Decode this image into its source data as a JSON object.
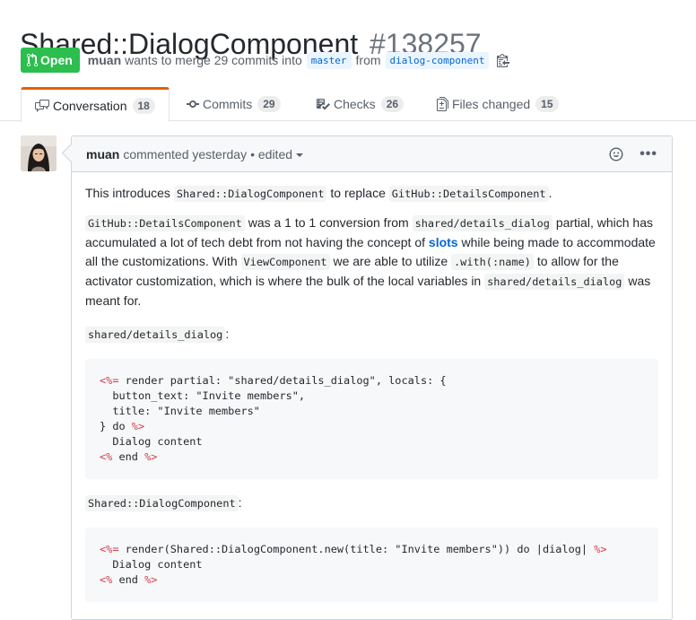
{
  "pr": {
    "title": "Shared::DialogComponent",
    "number": "#138257",
    "state": "Open",
    "author": "muan",
    "merge_text": "wants to merge 29 commits into",
    "base_branch": "master",
    "from_text": "from",
    "head_branch": "dialog-component"
  },
  "tabs": [
    {
      "label": "Conversation",
      "count": "18",
      "icon": "comment-discussion-icon"
    },
    {
      "label": "Commits",
      "count": "29",
      "icon": "commit-icon"
    },
    {
      "label": "Checks",
      "count": "26",
      "icon": "checklist-icon"
    },
    {
      "label": "Files changed",
      "count": "15",
      "icon": "file-diff-icon"
    }
  ],
  "comment": {
    "author": "muan",
    "meta": "commented yesterday",
    "edited": "• edited",
    "p1": {
      "a": "This introduces",
      "code1": "Shared::DialogComponent",
      "b": "to replace",
      "code2": "GitHub::DetailsComponent",
      "c": "."
    },
    "p2": {
      "code1": "GitHub::DetailsComponent",
      "a": "was a 1 to 1 conversion from",
      "code2": "shared/details_dialog",
      "b": "partial, which has accumulated a lot of tech debt from not having the concept of",
      "link": "slots",
      "c": "while being made to accommodate all the customizations. With",
      "code3": "ViewComponent",
      "d": "we are able to utilize",
      "code4": ".with(:name)",
      "e": "to allow for the activator customization, which is where the bulk of the local variables in",
      "code5": "shared/details_dialog",
      "f": "was meant for."
    },
    "p3": {
      "code": "shared/details_dialog",
      "colon": ":"
    },
    "code_block_1": [
      {
        "erb_open": "<%=",
        "text": " render partial: \"shared/details_dialog\", locals: {",
        "erb_close": ""
      },
      {
        "erb_open": "",
        "text": "  button_text: \"Invite members\",",
        "erb_close": ""
      },
      {
        "erb_open": "",
        "text": "  title: \"Invite members\"",
        "erb_close": ""
      },
      {
        "erb_open": "",
        "text": "} do ",
        "erb_close": "%>"
      },
      {
        "erb_open": "",
        "text": "  Dialog content",
        "erb_close": ""
      },
      {
        "erb_open": "<%",
        "text": " end ",
        "erb_close": "%>"
      }
    ],
    "p4": {
      "code": "Shared::DialogComponent",
      "colon": ":"
    },
    "code_block_2": [
      {
        "erb_open": "<%=",
        "text": " render(Shared::DialogComponent.new(title: \"Invite members\")) do |dialog| ",
        "erb_close": "%>"
      },
      {
        "erb_open": "",
        "text": "  Dialog content",
        "erb_close": ""
      },
      {
        "erb_open": "<%",
        "text": " end ",
        "erb_close": "%>"
      }
    ]
  },
  "colors": {
    "open_green": "#2cbe4e",
    "tab_accent": "#e36209",
    "link_blue": "#0366d6",
    "erb_red": "#d73a49"
  }
}
